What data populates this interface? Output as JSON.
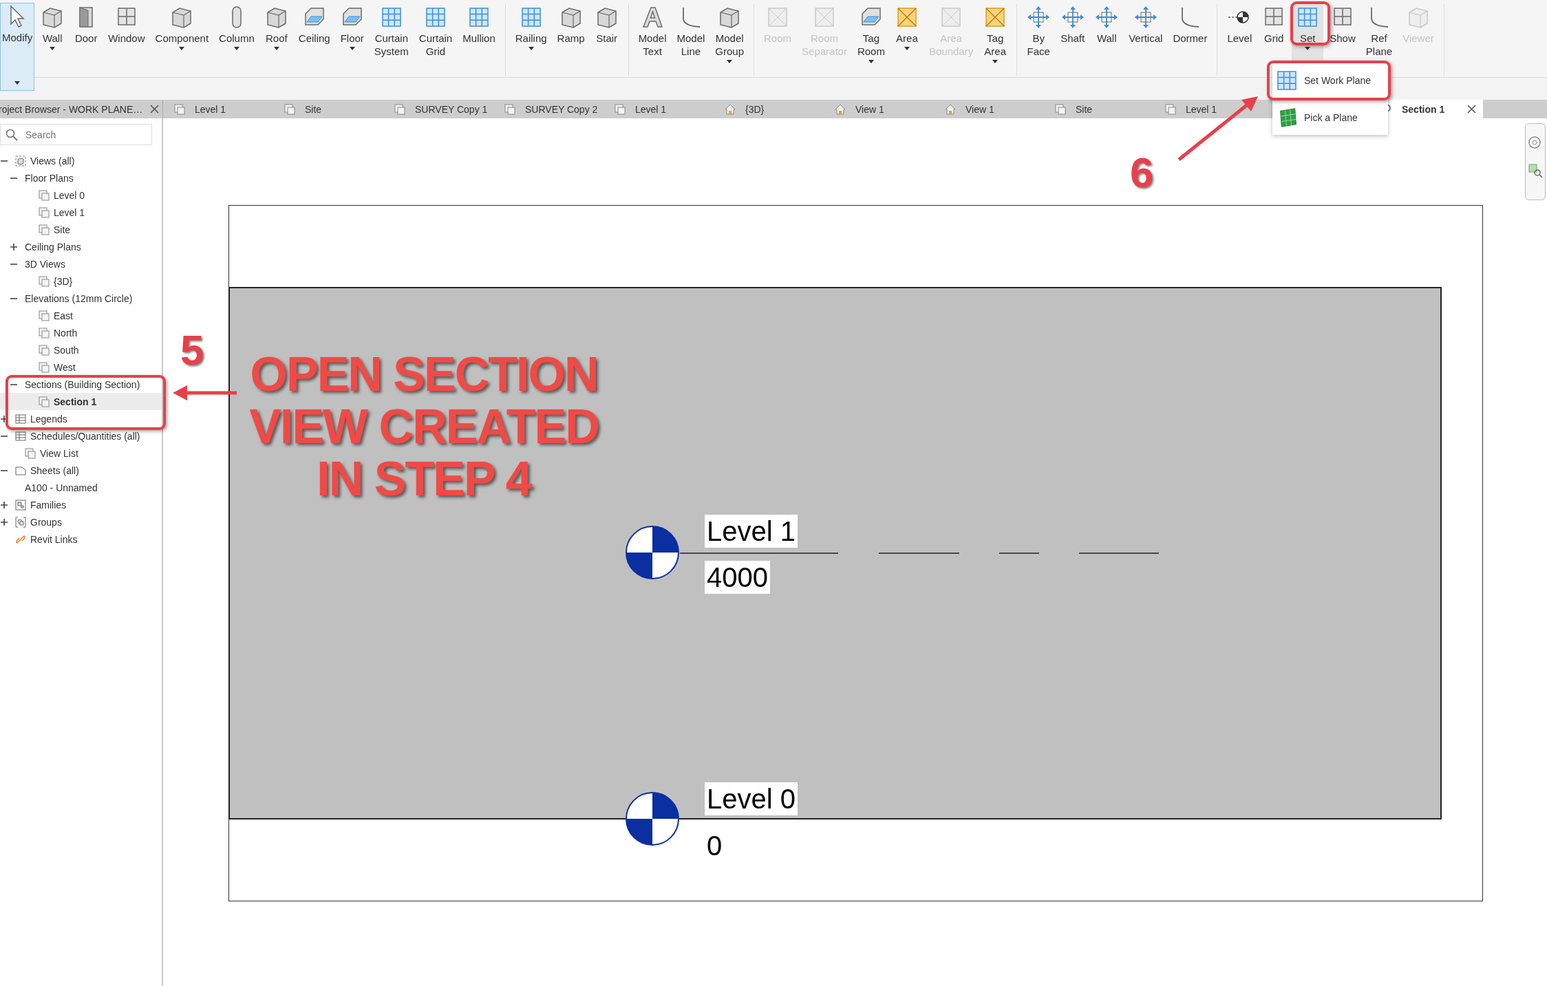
{
  "ribbon": {
    "panels": [
      {
        "items": [
          {
            "label": "Modify",
            "kind": "pointer",
            "selected": true,
            "pressed": false,
            "disabled": false,
            "dropdown": true
          },
          {
            "label": "Wall",
            "kind": "block",
            "selected": false,
            "pressed": false,
            "disabled": false,
            "dropdown": true
          },
          {
            "label": "Door",
            "kind": "door",
            "selected": false,
            "pressed": false,
            "disabled": false,
            "dropdown": false
          },
          {
            "label": "Window",
            "kind": "grid",
            "selected": false,
            "pressed": false,
            "disabled": false,
            "dropdown": false
          },
          {
            "label": "Component",
            "kind": "block",
            "selected": false,
            "pressed": false,
            "disabled": false,
            "dropdown": true
          },
          {
            "label": "Column",
            "kind": "column",
            "selected": false,
            "pressed": false,
            "disabled": false,
            "dropdown": true
          },
          {
            "label": "Roof",
            "kind": "block",
            "selected": false,
            "pressed": false,
            "disabled": false,
            "dropdown": true
          },
          {
            "label": "Ceiling",
            "kind": "plane",
            "selected": false,
            "pressed": false,
            "disabled": false,
            "dropdown": false
          },
          {
            "label": "Floor",
            "kind": "plane",
            "selected": false,
            "pressed": false,
            "disabled": false,
            "dropdown": true
          },
          {
            "label": "Curtain System",
            "kind": "bluegrid",
            "selected": false,
            "pressed": false,
            "disabled": false,
            "dropdown": false
          },
          {
            "label": "Curtain Grid",
            "kind": "bluegrid",
            "selected": false,
            "pressed": false,
            "disabled": false,
            "dropdown": false
          },
          {
            "label": "Mullion",
            "kind": "bluegrid",
            "selected": false,
            "pressed": false,
            "disabled": false,
            "dropdown": false
          }
        ]
      },
      {
        "items": [
          {
            "label": "Railing",
            "kind": "bluegrid",
            "selected": false,
            "pressed": false,
            "disabled": false,
            "dropdown": true
          },
          {
            "label": "Ramp",
            "kind": "block",
            "selected": false,
            "pressed": false,
            "disabled": false,
            "dropdown": false
          },
          {
            "label": "Stair",
            "kind": "block",
            "selected": false,
            "pressed": false,
            "disabled": false,
            "dropdown": false
          }
        ]
      },
      {
        "items": [
          {
            "label": "Model Text",
            "kind": "letter",
            "selected": false,
            "pressed": false,
            "disabled": false,
            "dropdown": false
          },
          {
            "label": "Model Line",
            "kind": "curve",
            "selected": false,
            "pressed": false,
            "disabled": false,
            "dropdown": false
          },
          {
            "label": "Model Group",
            "kind": "block",
            "selected": false,
            "pressed": false,
            "disabled": false,
            "dropdown": true
          }
        ]
      },
      {
        "items": [
          {
            "label": "Room",
            "kind": "cross",
            "selected": false,
            "pressed": false,
            "disabled": true,
            "dropdown": false
          },
          {
            "label": "Room Separator",
            "kind": "cross",
            "selected": false,
            "pressed": false,
            "disabled": true,
            "dropdown": false
          },
          {
            "label": "Tag Room",
            "kind": "plane",
            "selected": false,
            "pressed": false,
            "disabled": false,
            "dropdown": true
          },
          {
            "label": "Area",
            "kind": "yellowcross",
            "selected": false,
            "pressed": false,
            "disabled": false,
            "dropdown": true
          },
          {
            "label": "Area Boundary",
            "kind": "cross",
            "selected": false,
            "pressed": false,
            "disabled": true,
            "dropdown": false
          },
          {
            "label": "Tag Area",
            "kind": "yellowcross",
            "selected": false,
            "pressed": false,
            "disabled": false,
            "dropdown": true
          }
        ]
      },
      {
        "items": [
          {
            "label": "By Face",
            "kind": "arrows",
            "selected": false,
            "pressed": false,
            "disabled": false,
            "dropdown": false
          },
          {
            "label": "Shaft",
            "kind": "arrows",
            "selected": false,
            "pressed": false,
            "disabled": false,
            "dropdown": false
          },
          {
            "label": "Wall",
            "kind": "arrows",
            "selected": false,
            "pressed": false,
            "disabled": false,
            "dropdown": false
          },
          {
            "label": "Vertical",
            "kind": "arrows",
            "selected": false,
            "pressed": false,
            "disabled": false,
            "dropdown": false
          },
          {
            "label": "Dormer",
            "kind": "curve",
            "selected": false,
            "pressed": false,
            "disabled": false,
            "dropdown": false
          }
        ]
      },
      {
        "items": [
          {
            "label": "Level",
            "kind": "level",
            "selected": false,
            "pressed": false,
            "disabled": false,
            "dropdown": false
          },
          {
            "label": "Grid",
            "kind": "grid",
            "selected": false,
            "pressed": false,
            "disabled": false,
            "dropdown": false
          },
          {
            "label": "Set",
            "kind": "bluegrid",
            "selected": false,
            "pressed": true,
            "disabled": false,
            "dropdown": true
          },
          {
            "label": "Show",
            "kind": "grid",
            "selected": false,
            "pressed": false,
            "disabled": false,
            "dropdown": false
          },
          {
            "label": "Ref Plane",
            "kind": "curve",
            "selected": false,
            "pressed": false,
            "disabled": false,
            "dropdown": false
          },
          {
            "label": "Viewer",
            "kind": "block",
            "selected": false,
            "pressed": false,
            "disabled": true,
            "dropdown": false
          }
        ]
      }
    ]
  },
  "set_menu": [
    {
      "label": "Set Work Plane",
      "kind": "bluegrid",
      "highlighted": true
    },
    {
      "label": "Pick a Plane",
      "kind": "greengrid",
      "highlighted": false
    }
  ],
  "project_browser": {
    "title": "roject Browser - WORK PLANE…",
    "search": {
      "placeholder": "Search"
    },
    "tree": [
      {
        "label": "Views (all)",
        "kind": "views",
        "expanded": true,
        "selected": false,
        "children": [
          {
            "label": "Floor Plans",
            "expanded": true,
            "selected": false,
            "children": [
              {
                "label": "Level 0",
                "kind": "plan",
                "selected": false
              },
              {
                "label": "Level 1",
                "kind": "plan",
                "selected": false
              },
              {
                "label": "Site",
                "kind": "plan",
                "selected": false
              }
            ]
          },
          {
            "label": "Ceiling Plans",
            "expanded": false,
            "selected": false
          },
          {
            "label": "3D Views",
            "expanded": true,
            "selected": false,
            "children": [
              {
                "label": "{3D}",
                "kind": "plan",
                "selected": false
              }
            ]
          },
          {
            "label": "Elevations (12mm Circle)",
            "expanded": true,
            "selected": false,
            "children": [
              {
                "label": "East",
                "kind": "plan",
                "selected": false
              },
              {
                "label": "North",
                "kind": "plan",
                "selected": false
              },
              {
                "label": "South",
                "kind": "plan",
                "selected": false
              },
              {
                "label": "West",
                "kind": "plan",
                "selected": false
              }
            ]
          },
          {
            "label": "Sections (Building Section)",
            "expanded": true,
            "selected": false,
            "children": [
              {
                "label": "Section 1",
                "kind": "plan",
                "selected": true
              }
            ]
          }
        ]
      },
      {
        "label": "Legends",
        "kind": "table",
        "expanded": false,
        "selected": false
      },
      {
        "label": "Schedules/Quantities (all)",
        "kind": "table",
        "expanded": true,
        "selected": false,
        "children": [
          {
            "label": "View List",
            "kind": "plan",
            "selected": false
          }
        ]
      },
      {
        "label": "Sheets (all)",
        "kind": "sheet",
        "expanded": true,
        "selected": false,
        "children": [
          {
            "label": "A100 - Unnamed",
            "selected": false
          }
        ]
      },
      {
        "label": "Families",
        "kind": "family",
        "expanded": false,
        "selected": false
      },
      {
        "label": "Groups",
        "kind": "group",
        "expanded": false,
        "selected": false
      },
      {
        "label": "Revit Links",
        "kind": "link",
        "selected": false
      }
    ]
  },
  "view_tabs": [
    {
      "label": "Level 1",
      "kind": "plan",
      "selected": false
    },
    {
      "label": "Site",
      "kind": "plan",
      "selected": false
    },
    {
      "label": "SURVEY Copy 1",
      "kind": "plan",
      "selected": false
    },
    {
      "label": "SURVEY Copy 2",
      "kind": "plan",
      "selected": false
    },
    {
      "label": "Level 1",
      "kind": "plan",
      "selected": false
    },
    {
      "label": "{3D}",
      "kind": "house",
      "selected": false
    },
    {
      "label": "View 1",
      "kind": "house",
      "selected": false
    },
    {
      "label": "View 1",
      "kind": "house",
      "selected": false
    },
    {
      "label": "Site",
      "kind": "plan",
      "selected": false
    },
    {
      "label": "Level 1",
      "kind": "plan",
      "selected": false
    },
    {
      "label": "Section 1",
      "kind": "section",
      "selected": true
    }
  ],
  "section_view": {
    "levels": [
      {
        "name": "Level 1",
        "elevation": "4000"
      },
      {
        "name": "Level 0",
        "elevation": "0"
      }
    ]
  },
  "annotations": {
    "steps": [
      "5",
      "6"
    ],
    "note": [
      "OPEN SECTION",
      "VIEW CREATED",
      "IN STEP 4"
    ]
  }
}
